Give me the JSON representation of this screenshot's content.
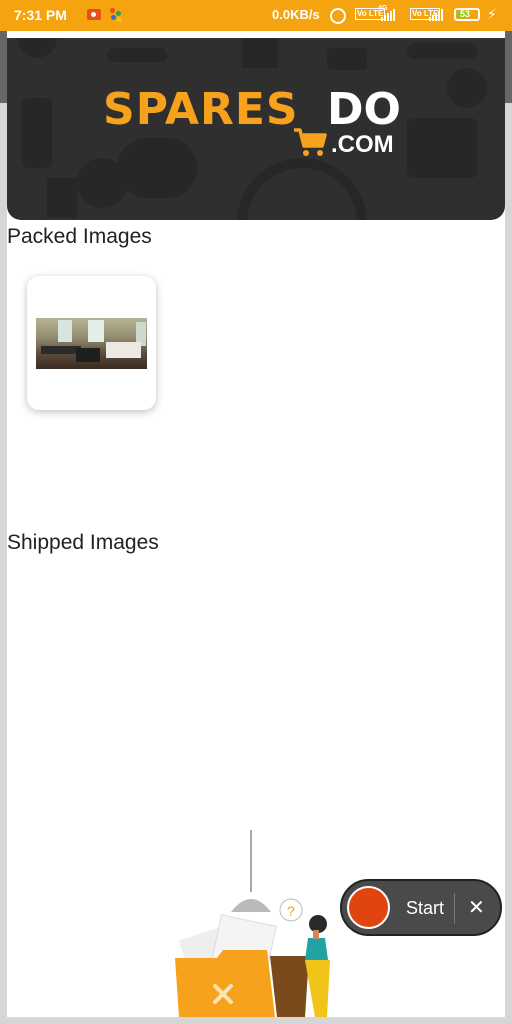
{
  "status_bar": {
    "time": "7:31 PM",
    "network_speed": "0.0KB/s",
    "volte1": "Vo LTE",
    "volte2": "Vo LTE",
    "network_type": "4G",
    "battery": "53"
  },
  "banner": {
    "logo_spares": "SPARES",
    "logo_do": "DO",
    "logo_com": ".COM",
    "brand_orange": "#f6a21c"
  },
  "sections": {
    "packed_title": "Packed Images",
    "shipped_title": "Shipped Images"
  },
  "recorder": {
    "start_label": "Start",
    "close_symbol": "✕"
  },
  "illustration": {
    "question_mark": "?",
    "folder_mark": "✕"
  }
}
